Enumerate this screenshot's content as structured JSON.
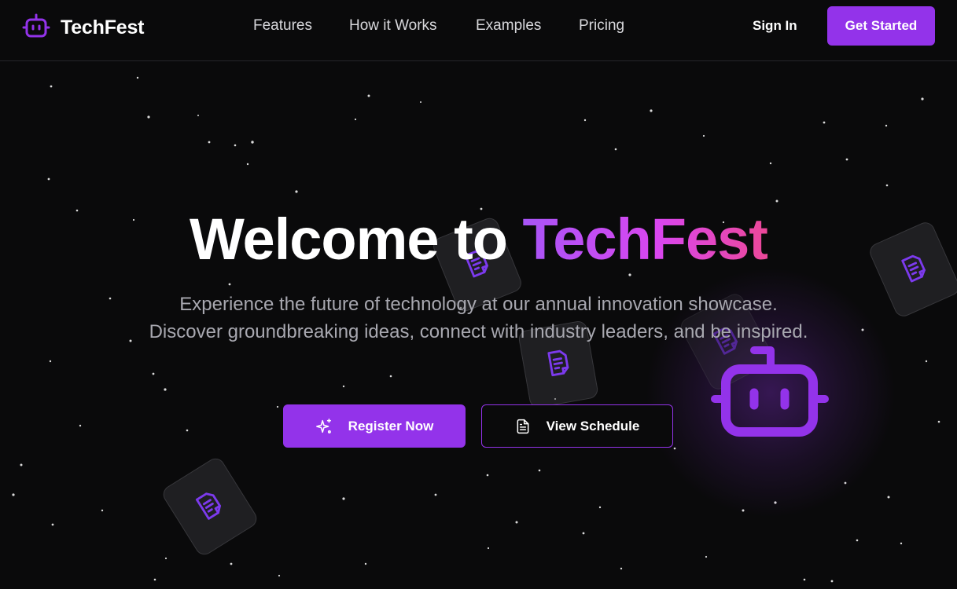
{
  "brand": {
    "name": "TechFest",
    "icon": "robot-icon"
  },
  "nav": {
    "links": [
      {
        "label": "Features"
      },
      {
        "label": "How it Works"
      },
      {
        "label": "Examples"
      },
      {
        "label": "Pricing"
      }
    ],
    "sign_in": "Sign In",
    "get_started": "Get Started"
  },
  "hero": {
    "title_prefix": "Welcome to ",
    "title_highlight": "TechFest",
    "subtitle": "Experience the future of technology at our annual innovation showcase. Discover groundbreaking ideas, connect with industry leaders, and be inspired.",
    "primary_button": {
      "label": "Register Now",
      "icon": "sparkles-icon"
    },
    "secondary_button": {
      "label": "View Schedule",
      "icon": "document-icon"
    }
  },
  "decor": {
    "floating_card_icon": "document-icon",
    "mascot_icon": "robot-icon"
  },
  "colors": {
    "background": "#0a0a0b",
    "accent": "#9333ea",
    "gradient_start": "#a855f7",
    "gradient_end": "#ec4899",
    "nav_text": "#d8d8dc",
    "subtitle_text": "#a8a8b0"
  }
}
